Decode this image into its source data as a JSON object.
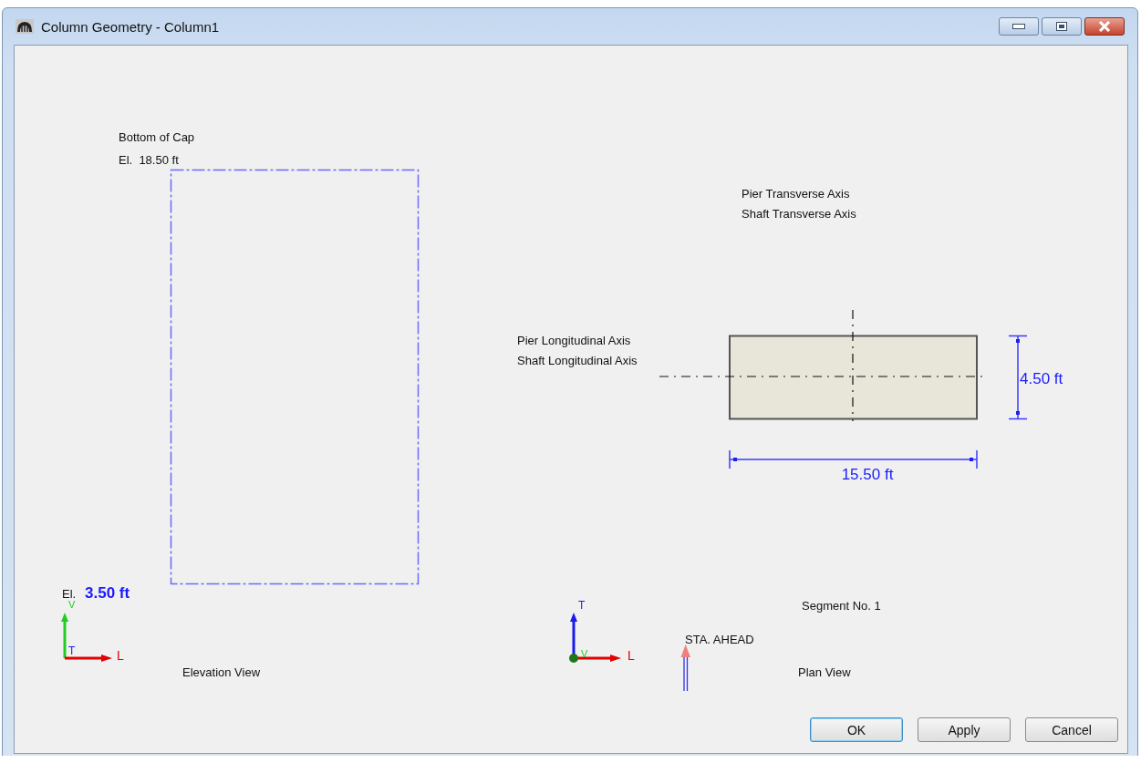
{
  "window": {
    "title": "Column Geometry - Column1"
  },
  "elevation_view": {
    "top_label": "Bottom of Cap",
    "top_elevation": "El.  18.50 ft",
    "bottom_elevation_label": "El.",
    "bottom_elevation_value": "3.50 ft",
    "axes": {
      "vertical": "V",
      "out": "T",
      "horizontal": "L"
    },
    "title": "Elevation View"
  },
  "plan_view": {
    "transverse_axis_labels": [
      "Pier Transverse Axis",
      "Shaft Transverse Axis"
    ],
    "longitudinal_axis_labels": [
      "Pier Longitudinal Axis",
      "Shaft Longitudinal Axis"
    ],
    "depth_dimension": "4.50 ft",
    "width_dimension": "15.50 ft",
    "segment_label": "Segment No. 1",
    "axes": {
      "vertical": "T",
      "out": "V",
      "horizontal": "L"
    },
    "station_label": "STA. AHEAD",
    "title": "Plan View"
  },
  "buttons": [
    {
      "label": "OK",
      "default": true
    },
    {
      "label": "Apply",
      "default": false
    },
    {
      "label": "Cancel",
      "default": false
    }
  ]
}
